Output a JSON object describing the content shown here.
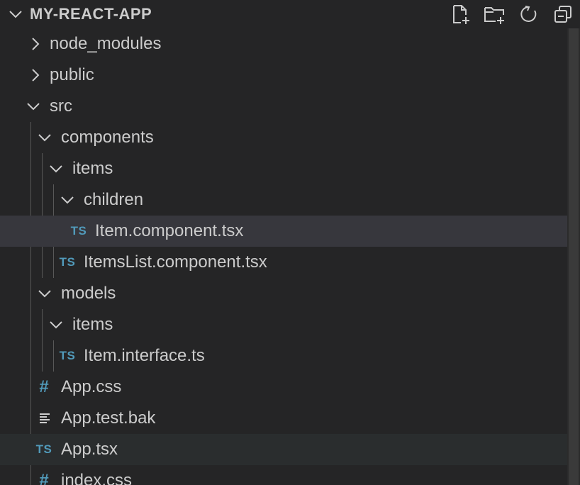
{
  "explorer": {
    "title": "MY-REACT-APP",
    "actions": [
      {
        "name": "new-file-icon"
      },
      {
        "name": "new-folder-icon"
      },
      {
        "name": "refresh-icon"
      },
      {
        "name": "collapse-all-icon"
      }
    ]
  },
  "tree": {
    "items": [
      {
        "label": "node_modules",
        "type": "folder",
        "expanded": false,
        "depth": 0
      },
      {
        "label": "public",
        "type": "folder",
        "expanded": false,
        "depth": 0
      },
      {
        "label": "src",
        "type": "folder",
        "expanded": true,
        "depth": 0
      },
      {
        "label": "components",
        "type": "folder",
        "expanded": true,
        "depth": 1
      },
      {
        "label": "items",
        "type": "folder",
        "expanded": true,
        "depth": 2
      },
      {
        "label": "children",
        "type": "folder",
        "expanded": true,
        "depth": 3
      },
      {
        "label": "Item.component.tsx",
        "type": "ts",
        "icon_text": "TS",
        "depth": 4,
        "selected": true
      },
      {
        "label": "ItemsList.component.tsx",
        "type": "ts",
        "icon_text": "TS",
        "depth": 3
      },
      {
        "label": "models",
        "type": "folder",
        "expanded": true,
        "depth": 1
      },
      {
        "label": "items",
        "type": "folder",
        "expanded": true,
        "depth": 2
      },
      {
        "label": "Item.interface.ts",
        "type": "ts",
        "icon_text": "TS",
        "depth": 3
      },
      {
        "label": "App.css",
        "type": "css",
        "icon_text": "#",
        "depth": 1
      },
      {
        "label": "App.test.bak",
        "type": "text",
        "depth": 1
      },
      {
        "label": "App.tsx",
        "type": "ts",
        "icon_text": "TS",
        "depth": 1,
        "hover": true
      },
      {
        "label": "index.css",
        "type": "css",
        "icon_text": "#",
        "depth": 1
      }
    ]
  },
  "colors": {
    "background": "#252526",
    "selected_row": "#37373d",
    "hover_row": "#2a2d2e",
    "text": "#cccccc",
    "ts_icon": "#519aba",
    "indent_guide": "#585858"
  }
}
